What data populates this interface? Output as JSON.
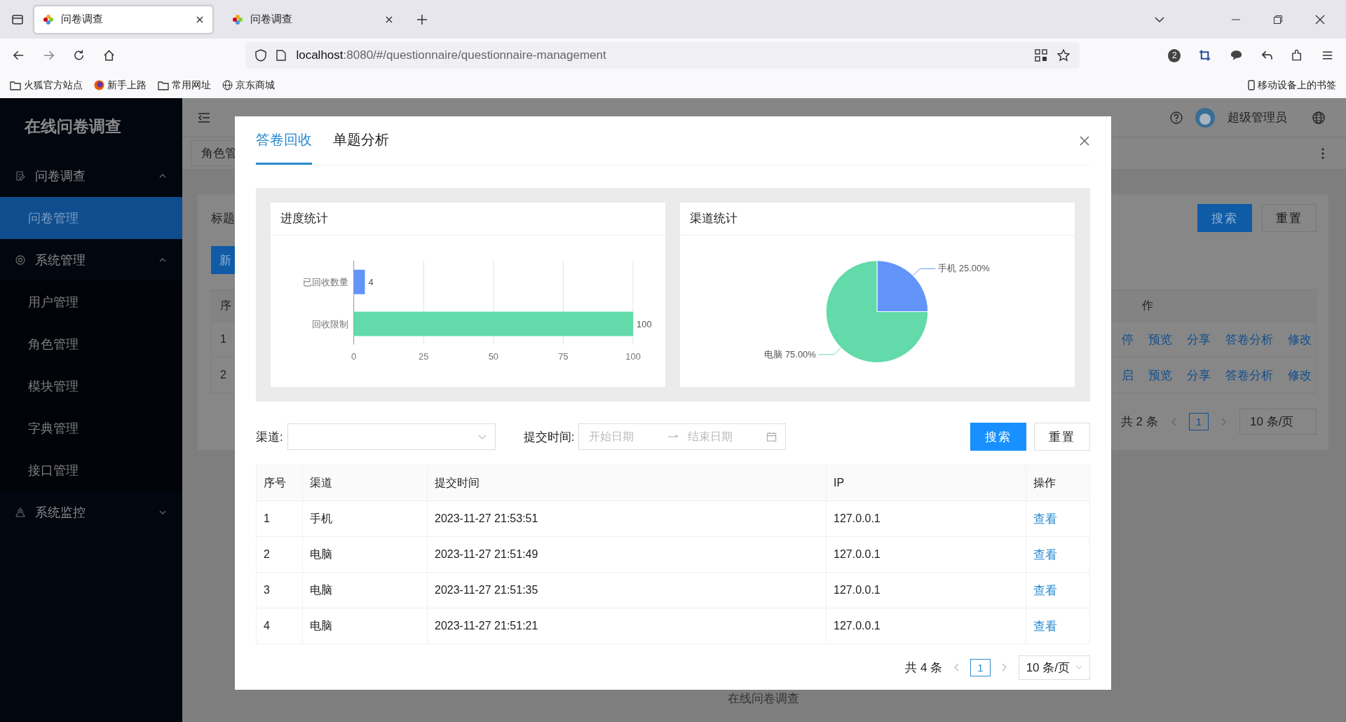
{
  "browser": {
    "tabs": [
      {
        "title": "问卷调查",
        "selected": true
      },
      {
        "title": "问卷调查",
        "selected": false
      }
    ],
    "url_host": "localhost",
    "url_rest": ":8080/#/questionnaire/questionnaire-management",
    "notification_count": "2",
    "bookmarks": [
      "火狐官方站点",
      "新手上路",
      "常用网址",
      "京东商城"
    ],
    "mobile_bookmarks": "移动设备上的书签"
  },
  "sidebar": {
    "title": "在线问卷调查",
    "groups": [
      {
        "label": "问卷调查",
        "expanded": true,
        "items": [
          {
            "label": "问卷管理",
            "selected": true
          }
        ]
      },
      {
        "label": "系统管理",
        "expanded": true,
        "items": [
          {
            "label": "用户管理",
            "selected": false
          },
          {
            "label": "角色管理",
            "selected": false
          },
          {
            "label": "模块管理",
            "selected": false
          },
          {
            "label": "字典管理",
            "selected": false
          },
          {
            "label": "接口管理",
            "selected": false
          }
        ]
      },
      {
        "label": "系统监控",
        "expanded": false
      }
    ]
  },
  "header": {
    "user": "超级管理员"
  },
  "page": {
    "tag": "角色管",
    "filter_label": "标题",
    "buttons": [
      "搜索",
      "重置"
    ],
    "new_button": "新",
    "table": {
      "header_left": "序",
      "header_right": "作",
      "rows": [
        {
          "index": "1",
          "status_action": "停",
          "actions": [
            "预览",
            "分享",
            "答卷分析",
            "修改"
          ]
        },
        {
          "index": "2",
          "status_action": "启",
          "actions": [
            "预览",
            "分享",
            "答卷分析",
            "修改"
          ]
        }
      ]
    },
    "pagination": {
      "total": "共 2 条",
      "page": "1",
      "page_size": "10 条/页"
    }
  },
  "footer": "在线问卷调查",
  "dialog": {
    "tabs": [
      {
        "label": "答卷回收",
        "selected": true
      },
      {
        "label": "单题分析",
        "selected": false
      }
    ],
    "progress_card": {
      "title": "进度统计",
      "chart_data": {
        "type": "bar",
        "orientation": "horizontal",
        "categories": [
          "已回收数量",
          "回收限制"
        ],
        "values": [
          4,
          100
        ],
        "colors": [
          "#6394f9",
          "#62daaa"
        ],
        "xlim": [
          0,
          100
        ],
        "xticks": [
          0,
          25,
          50,
          75,
          100
        ],
        "grid": true,
        "data_labels": true
      }
    },
    "channel_card": {
      "title": "渠道统计",
      "chart_data": {
        "type": "pie",
        "categories": [
          "手机",
          "电脑"
        ],
        "values": [
          25,
          75
        ],
        "colors": [
          "#6394f9",
          "#62daaa"
        ],
        "value_labels": [
          "25.00%",
          "75.00%"
        ]
      }
    },
    "filters": {
      "channel_label": "渠道:",
      "time_label": "提交时间:",
      "start_placeholder": "开始日期",
      "end_placeholder": "结束日期"
    },
    "buttons": [
      "搜索",
      "重置"
    ],
    "table": {
      "columns": [
        "序号",
        "渠道",
        "提交时间",
        "IP",
        "操作"
      ],
      "rows": [
        {
          "cells": [
            "1",
            "手机",
            "2023-11-27 21:53:51",
            "127.0.0.1"
          ],
          "action": "查看"
        },
        {
          "cells": [
            "2",
            "电脑",
            "2023-11-27 21:51:49",
            "127.0.0.1"
          ],
          "action": "查看"
        },
        {
          "cells": [
            "3",
            "电脑",
            "2023-11-27 21:51:35",
            "127.0.0.1"
          ],
          "action": "查看"
        },
        {
          "cells": [
            "4",
            "电脑",
            "2023-11-27 21:51:21",
            "127.0.0.1"
          ],
          "action": "查看"
        }
      ]
    },
    "pagination": {
      "total": "共 4 条",
      "page": "1",
      "page_size": "10 条/页"
    }
  }
}
